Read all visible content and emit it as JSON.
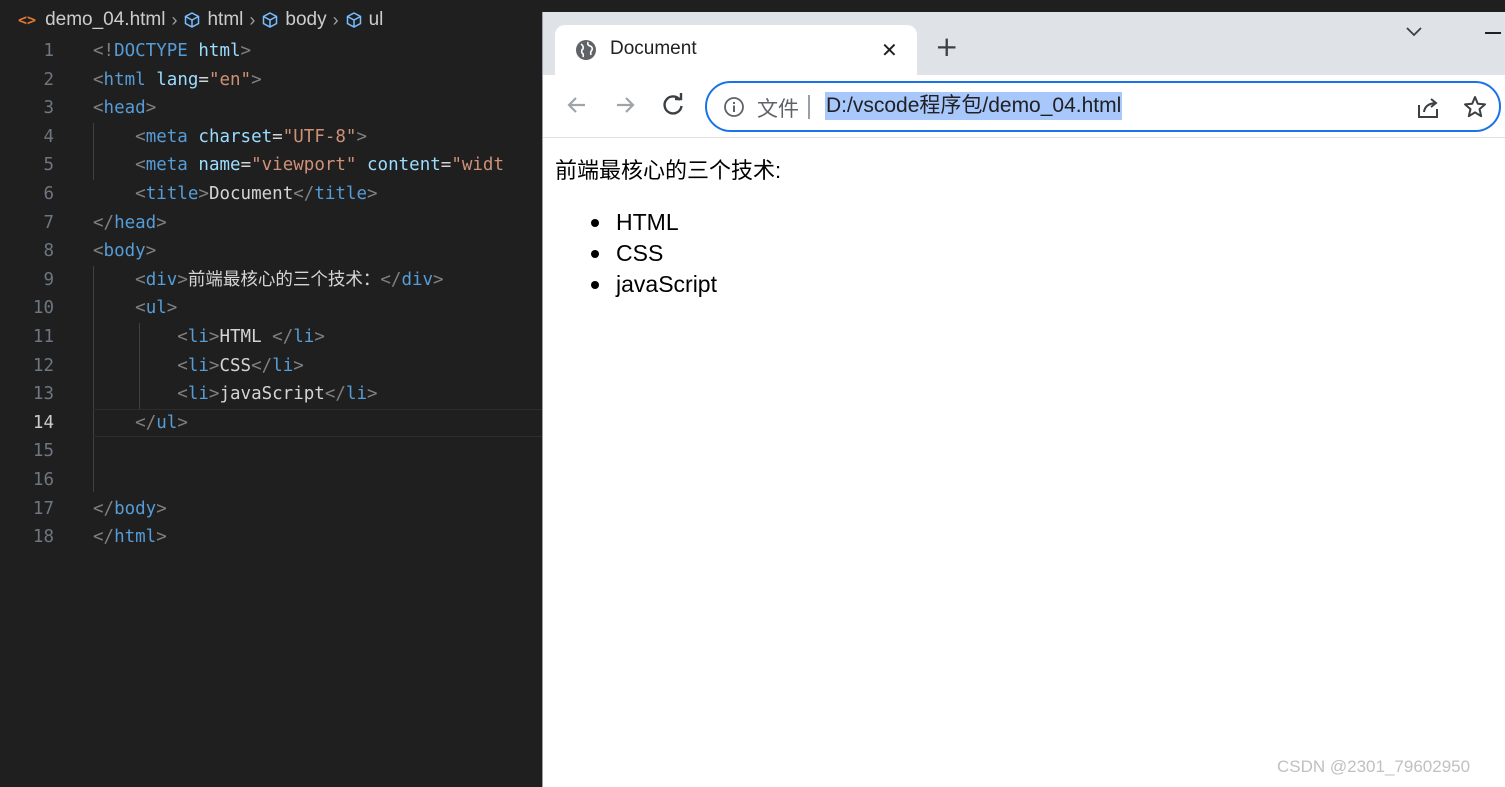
{
  "editor": {
    "breadcrumb": {
      "file_icon": "<>",
      "file": "demo_04.html",
      "items": [
        "html",
        "body",
        "ul"
      ]
    },
    "lines": [
      {
        "num": "1",
        "tokens": [
          [
            "b",
            "<!"
          ],
          [
            "t",
            "DOCTYPE"
          ],
          [
            "w",
            " "
          ],
          [
            "a",
            "html"
          ],
          [
            "b",
            ">"
          ]
        ]
      },
      {
        "num": "2",
        "tokens": [
          [
            "b",
            "<"
          ],
          [
            "t",
            "html"
          ],
          [
            "w",
            " "
          ],
          [
            "a",
            "lang"
          ],
          [
            "w",
            "="
          ],
          [
            "s",
            "\"en\""
          ],
          [
            "b",
            ">"
          ]
        ]
      },
      {
        "num": "3",
        "tokens": [
          [
            "b",
            "<"
          ],
          [
            "t",
            "head"
          ],
          [
            "b",
            ">"
          ]
        ]
      },
      {
        "num": "4",
        "tokens": [
          [
            "w",
            "    "
          ],
          [
            "b",
            "<"
          ],
          [
            "t",
            "meta"
          ],
          [
            "w",
            " "
          ],
          [
            "a",
            "charset"
          ],
          [
            "w",
            "="
          ],
          [
            "s",
            "\"UTF-8\""
          ],
          [
            "b",
            ">"
          ]
        ]
      },
      {
        "num": "5",
        "tokens": [
          [
            "w",
            "    "
          ],
          [
            "b",
            "<"
          ],
          [
            "t",
            "meta"
          ],
          [
            "w",
            " "
          ],
          [
            "a",
            "name"
          ],
          [
            "w",
            "="
          ],
          [
            "s",
            "\"viewport\""
          ],
          [
            "w",
            " "
          ],
          [
            "a",
            "content"
          ],
          [
            "w",
            "="
          ],
          [
            "s",
            "\"widt"
          ]
        ]
      },
      {
        "num": "6",
        "tokens": [
          [
            "w",
            "    "
          ],
          [
            "b",
            "<"
          ],
          [
            "t",
            "title"
          ],
          [
            "b",
            ">"
          ],
          [
            "w",
            "Document"
          ],
          [
            "b",
            "</"
          ],
          [
            "t",
            "title"
          ],
          [
            "b",
            ">"
          ]
        ]
      },
      {
        "num": "7",
        "tokens": [
          [
            "b",
            "</"
          ],
          [
            "t",
            "head"
          ],
          [
            "b",
            ">"
          ]
        ]
      },
      {
        "num": "8",
        "tokens": [
          [
            "b",
            "<"
          ],
          [
            "t",
            "body"
          ],
          [
            "b",
            ">"
          ]
        ]
      },
      {
        "num": "9",
        "tokens": [
          [
            "w",
            "    "
          ],
          [
            "b",
            "<"
          ],
          [
            "t",
            "div"
          ],
          [
            "b",
            ">"
          ],
          [
            "w",
            "前端最核心的三个技术："
          ],
          [
            "b",
            "</"
          ],
          [
            "t",
            "div"
          ],
          [
            "b",
            ">"
          ]
        ]
      },
      {
        "num": "10",
        "tokens": [
          [
            "w",
            "    "
          ],
          [
            "b",
            "<"
          ],
          [
            "t",
            "ul"
          ],
          [
            "b",
            ">"
          ]
        ]
      },
      {
        "num": "11",
        "tokens": [
          [
            "w",
            "        "
          ],
          [
            "b",
            "<"
          ],
          [
            "t",
            "li"
          ],
          [
            "b",
            ">"
          ],
          [
            "w",
            "HTML "
          ],
          [
            "b",
            "</"
          ],
          [
            "t",
            "li"
          ],
          [
            "b",
            ">"
          ]
        ]
      },
      {
        "num": "12",
        "tokens": [
          [
            "w",
            "        "
          ],
          [
            "b",
            "<"
          ],
          [
            "t",
            "li"
          ],
          [
            "b",
            ">"
          ],
          [
            "w",
            "CSS"
          ],
          [
            "b",
            "</"
          ],
          [
            "t",
            "li"
          ],
          [
            "b",
            ">"
          ]
        ]
      },
      {
        "num": "13",
        "tokens": [
          [
            "w",
            "        "
          ],
          [
            "b",
            "<"
          ],
          [
            "t",
            "li"
          ],
          [
            "b",
            ">"
          ],
          [
            "w",
            "javaScript"
          ],
          [
            "b",
            "</"
          ],
          [
            "t",
            "li"
          ],
          [
            "b",
            ">"
          ]
        ]
      },
      {
        "num": "14",
        "tokens": [
          [
            "w",
            "    "
          ],
          [
            "b",
            "</"
          ],
          [
            "t",
            "ul"
          ],
          [
            "b",
            ">"
          ]
        ],
        "active": true
      },
      {
        "num": "15",
        "tokens": []
      },
      {
        "num": "16",
        "tokens": []
      },
      {
        "num": "17",
        "tokens": [
          [
            "b",
            "</"
          ],
          [
            "t",
            "body"
          ],
          [
            "b",
            ">"
          ]
        ]
      },
      {
        "num": "18",
        "tokens": [
          [
            "b",
            "</"
          ],
          [
            "t",
            "html"
          ],
          [
            "b",
            ">"
          ]
        ]
      }
    ]
  },
  "browser": {
    "tab_title": "Document",
    "tab_close": "✕",
    "new_tab": "+",
    "omnibox": {
      "label": "文件",
      "url": "D:/vscode程序包/demo_04.html"
    },
    "page": {
      "heading": "前端最核心的三个技术:",
      "items": [
        "HTML",
        "CSS",
        "javaScript"
      ]
    }
  },
  "watermark": "CSDN @2301_79602950",
  "colors": {
    "editor_bg": "#1f1f1f",
    "tag": "#569cd6",
    "attr": "#9cdcfe",
    "string": "#ce9178",
    "accent": "#1a73e8",
    "url_highlight": "#a8c7fa"
  }
}
